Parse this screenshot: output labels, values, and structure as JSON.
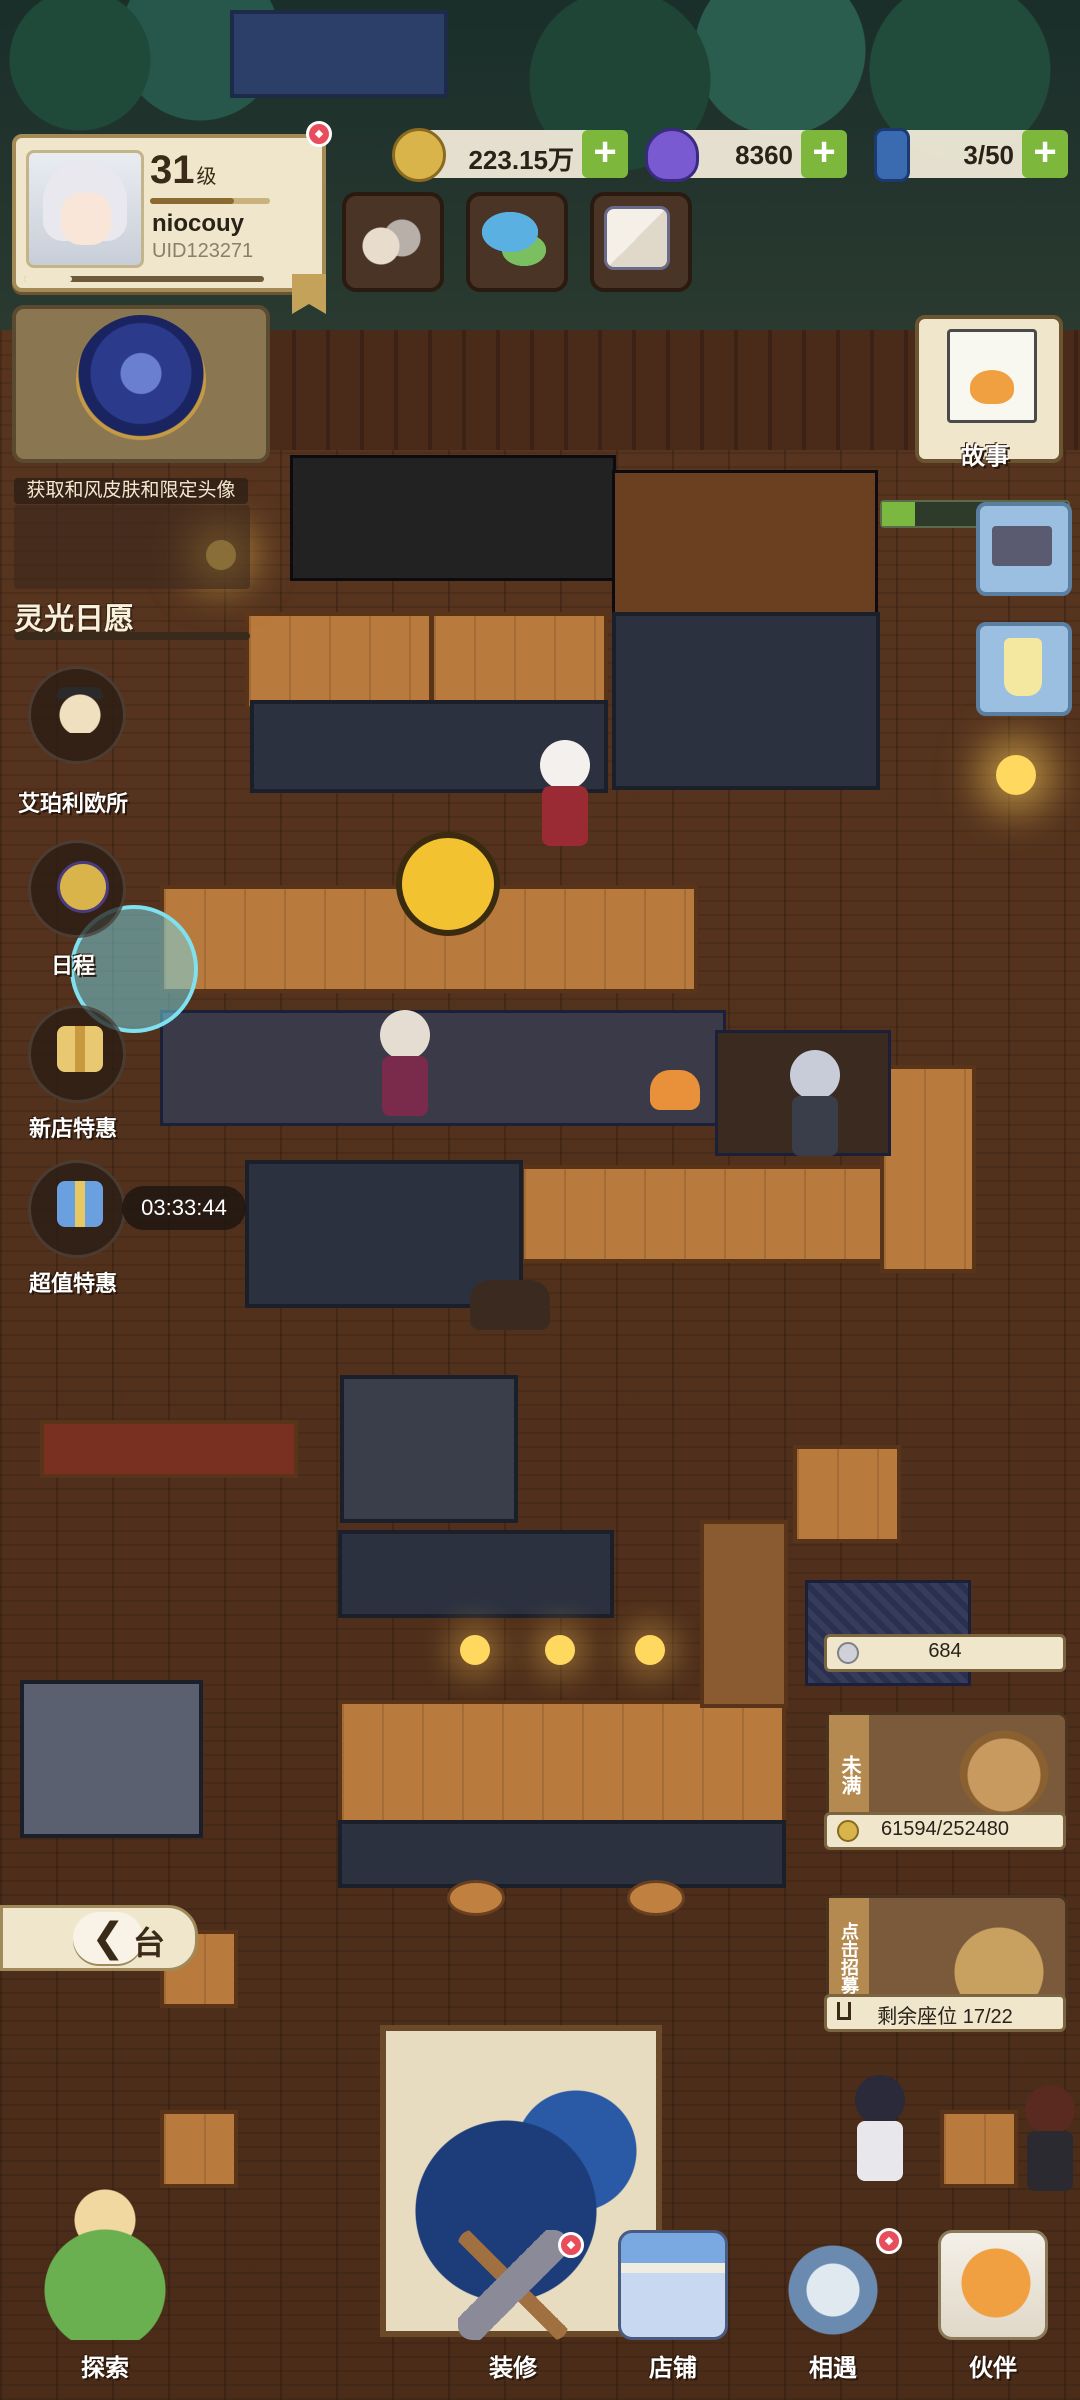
{
  "player": {
    "level": "31",
    "level_unit": "级",
    "name": "niocouy",
    "uid": "UID123271",
    "level_progress": 0.7,
    "xp_progress": 0.2
  },
  "currencies": [
    {
      "icon": "gold-coin-icon",
      "value": "223.15万",
      "color": "#d8b44a"
    },
    {
      "icon": "purple-gem-icon",
      "value": "8360",
      "color": "#7a5ad0"
    },
    {
      "icon": "potion-bottle-icon",
      "value": "3/50",
      "color": "#3a6ab0"
    }
  ],
  "plus_label": "+",
  "event": {
    "banner": "获取和风皮肤和限定头像",
    "title": "灵光日愿"
  },
  "side_menu": [
    {
      "name": "office",
      "label": "艾珀利欧所",
      "icon": "owl-detective-icon"
    },
    {
      "name": "schedule",
      "label": "日程",
      "icon": "calendar-badge-icon"
    },
    {
      "name": "new-shop-deal",
      "label": "新店特惠",
      "icon": "gift-box-icon"
    },
    {
      "name": "value-deal",
      "label": "超值特惠",
      "icon": "blue-gift-icon"
    }
  ],
  "deal_timer": "03:33:44",
  "story": {
    "label": "故事"
  },
  "shop_stats": {
    "pill_value": "684",
    "reward_tag": "未满",
    "reward_progress": "61594/252480",
    "recruit_tag": "点击招募",
    "seats": "剩余座位 17/22"
  },
  "back_button": {
    "arrow": "❮",
    "text": "台"
  },
  "bottom_nav": [
    {
      "name": "explore",
      "label": "探索"
    },
    {
      "name": "decorate",
      "label": "装修"
    },
    {
      "name": "shop",
      "label": "店铺"
    },
    {
      "name": "encounter",
      "label": "相遇"
    },
    {
      "name": "partner",
      "label": "伙伴"
    }
  ],
  "colors": {
    "accent_green": "#7db83c",
    "badge_red": "#e84d5c",
    "panel_cream": "#efe6cc"
  }
}
